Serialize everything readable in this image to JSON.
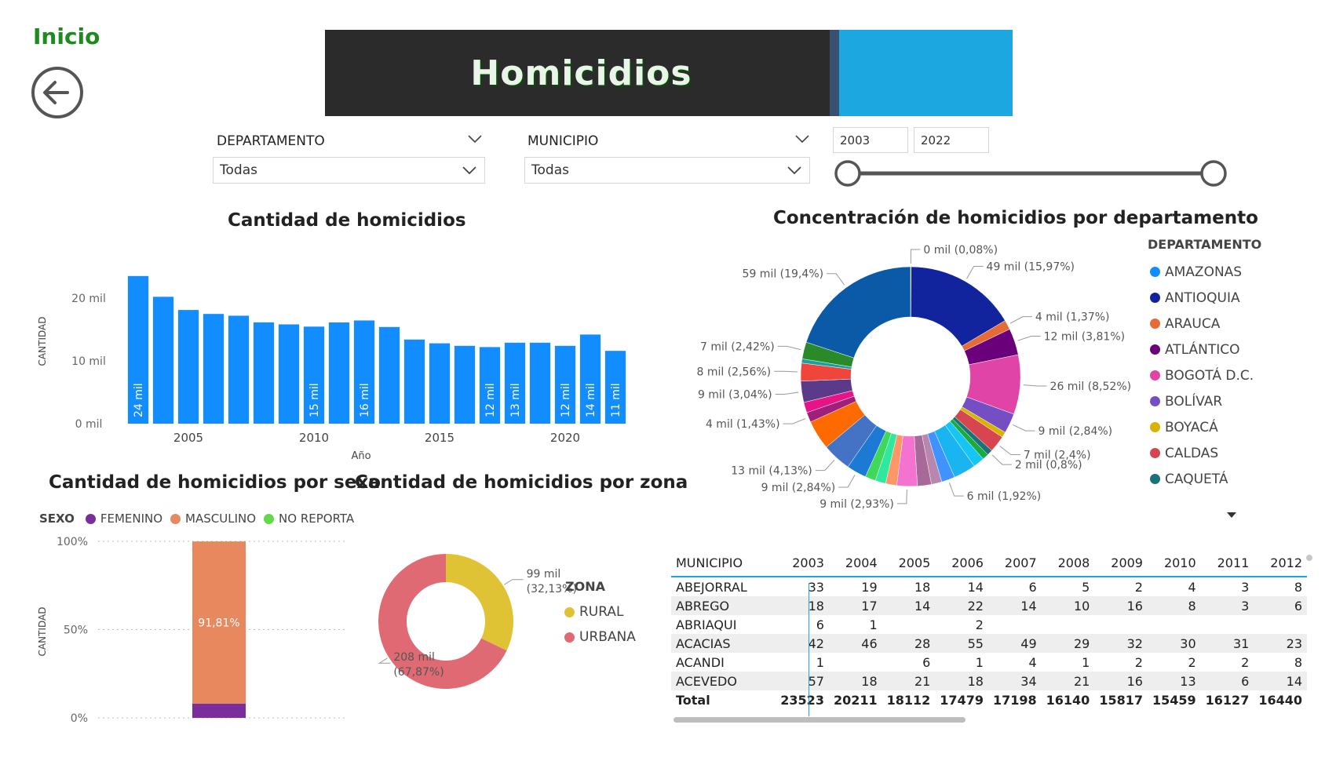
{
  "nav": {
    "label": "Inicio",
    "back_icon": "arrow-left-circle-icon"
  },
  "banner": {
    "title": "Homicidios",
    "colors": {
      "dark": "#2b2b2b",
      "accent": "#1ca7e0"
    }
  },
  "filters": {
    "departamento": {
      "label": "DEPARTAMENTO",
      "value": "Todas"
    },
    "municipio": {
      "label": "MUNICIPIO",
      "value": "Todas"
    },
    "year_range": {
      "start": "2003",
      "end": "2022"
    }
  },
  "charts": [
    {
      "id": "yearly",
      "chart_data": {
        "type": "bar",
        "title": "Cantidad de homicidios",
        "xlabel": "Año",
        "ylabel": "CANTIDAD",
        "x": [
          2003,
          2004,
          2005,
          2006,
          2007,
          2008,
          2009,
          2010,
          2011,
          2012,
          2013,
          2014,
          2015,
          2016,
          2017,
          2018,
          2019,
          2020,
          2021,
          2022
        ],
        "values": [
          23523,
          20211,
          18112,
          17479,
          17198,
          16140,
          15817,
          15459,
          16127,
          16440,
          15400,
          13400,
          12800,
          12400,
          12200,
          12900,
          12900,
          12400,
          14200,
          11600
        ],
        "data_labels": [
          "24 mil",
          "",
          "",
          "",
          "",
          "",
          "",
          "15 mil",
          "",
          "16 mil",
          "",
          "",
          "",
          "",
          "12 mil",
          "13 mil",
          "",
          "12 mil",
          "14 mil",
          "11 mil"
        ],
        "ylim": [
          0,
          25000
        ],
        "yticks": [
          {
            "v": 0,
            "label": "0 mil"
          },
          {
            "v": 10000,
            "label": "10 mil"
          },
          {
            "v": 20000,
            "label": "20 mil"
          }
        ],
        "xticks": [
          2005,
          2010,
          2015,
          2020
        ],
        "color": "#118dff"
      }
    },
    {
      "id": "departamento",
      "chart_data": {
        "type": "pie",
        "title": "Concentración de homicidios por departamento",
        "legend_title": "DEPARTAMENTO",
        "legend": [
          {
            "name": "AMAZONAS",
            "color": "#118dff"
          },
          {
            "name": "ANTIOQUIA",
            "color": "#12239e"
          },
          {
            "name": "ARAUCA",
            "color": "#e66c37"
          },
          {
            "name": "ATLÁNTICO",
            "color": "#6b007b"
          },
          {
            "name": "BOGOTÁ D.C.",
            "color": "#e044a7"
          },
          {
            "name": "BOLÍVAR",
            "color": "#744ec2"
          },
          {
            "name": "BOYACÁ",
            "color": "#d9b300"
          },
          {
            "name": "CALDAS",
            "color": "#d64550"
          },
          {
            "name": "CAQUETÁ",
            "color": "#197278"
          }
        ],
        "slices": [
          {
            "value": 0.08,
            "color": "#e66c37",
            "label": "0 mil (0,08%)"
          },
          {
            "value": 15.97,
            "color": "#12239e",
            "label": "49 mil (15,97%)"
          },
          {
            "value": 1.37,
            "color": "#e66c37",
            "label": "4 mil (1,37%)"
          },
          {
            "value": 3.81,
            "color": "#6b007b",
            "label": "12 mil (3,81%)"
          },
          {
            "value": 8.52,
            "color": "#e044a7",
            "label": "26 mil (8,52%)"
          },
          {
            "value": 2.84,
            "color": "#744ec2",
            "label": "9 mil (2,84%)"
          },
          {
            "value": 0.8,
            "color": "#d9b300",
            "label": ""
          },
          {
            "value": 2.4,
            "color": "#d64550",
            "label": "7 mil (2,4%)"
          },
          {
            "value": 0.8,
            "color": "#197278",
            "label": "2 mil (0,8%)"
          },
          {
            "value": 0.9,
            "color": "#1aab40",
            "label": ""
          },
          {
            "value": 1.6,
            "color": "#15c6f4",
            "label": ""
          },
          {
            "value": 3.2,
            "color": "#1ab5f0",
            "label": ""
          },
          {
            "value": 1.92,
            "color": "#4092ff",
            "label": "6 mil (1,92%)"
          },
          {
            "value": 1.5,
            "color": "#b887ad",
            "label": ""
          },
          {
            "value": 2.0,
            "color": "#a66999",
            "label": ""
          },
          {
            "value": 2.93,
            "color": "#f472d0",
            "label": "9 mil (2,93%)"
          },
          {
            "value": 1.6,
            "color": "#fe9666",
            "label": ""
          },
          {
            "value": 1.5,
            "color": "#2ee8a0",
            "label": ""
          },
          {
            "value": 1.5,
            "color": "#3fd85a",
            "label": ""
          },
          {
            "value": 2.84,
            "color": "#1d7ad4",
            "label": "9 mil (2,84%)"
          },
          {
            "value": 4.13,
            "color": "#4472c4",
            "label": "13 mil (4,13%)"
          },
          {
            "value": 4.2,
            "color": "#ff6a00",
            "label": ""
          },
          {
            "value": 1.43,
            "color": "#a01f7a",
            "label": "4 mil (1,43%)"
          },
          {
            "value": 1.5,
            "color": "#e81487",
            "label": ""
          },
          {
            "value": 3.04,
            "color": "#5b3a8a",
            "label": "9 mil (3,04%)"
          },
          {
            "value": 2.56,
            "color": "#f0453a",
            "label": "8 mil (2,56%)"
          },
          {
            "value": 0.6,
            "color": "#1aa0a0",
            "label": ""
          },
          {
            "value": 2.42,
            "color": "#2a8a2a",
            "label": "7 mil (2,42%)"
          },
          {
            "value": 19.4,
            "color": "#0a5aa8",
            "label": "59 mil (19,4%)"
          }
        ]
      }
    },
    {
      "id": "sexo",
      "chart_data": {
        "type": "bar",
        "title": "Cantidad de homicidios por sexo",
        "ylabel": "CANTIDAD",
        "legend_title": "SEXO",
        "series": [
          {
            "name": "FEMENINO",
            "color": "#7b2d9b",
            "value": 8.1
          },
          {
            "name": "MASCULINO",
            "color": "#e8885e",
            "value": 91.81,
            "label": "91,81%"
          },
          {
            "name": "NO REPORTA",
            "color": "#62d94a",
            "value": 0.09
          }
        ],
        "yticks": [
          "0%",
          "50%",
          "100%"
        ],
        "ylim": [
          0,
          100
        ]
      }
    },
    {
      "id": "zona",
      "chart_data": {
        "type": "pie",
        "title": "Cantidad de homicidios por zona",
        "legend_title": "ZONA",
        "slices": [
          {
            "name": "RURAL",
            "value": 32.13,
            "color": "#e0c235",
            "label_top": "99 mil",
            "label_bottom": "(32,13%)"
          },
          {
            "name": "URBANA",
            "value": 67.87,
            "color": "#e06a73",
            "label_top": "208 mil",
            "label_bottom": "(67,87%)"
          }
        ]
      }
    }
  ],
  "table": {
    "headers": [
      "MUNICIPIO",
      "2003",
      "2004",
      "2005",
      "2006",
      "2007",
      "2008",
      "2009",
      "2010",
      "2011",
      "2012"
    ],
    "rows": [
      [
        "ABEJORRAL",
        "33",
        "19",
        "18",
        "14",
        "6",
        "5",
        "2",
        "4",
        "3",
        "8"
      ],
      [
        "ABREGO",
        "18",
        "17",
        "14",
        "22",
        "14",
        "10",
        "16",
        "8",
        "3",
        "6"
      ],
      [
        "ABRIAQUI",
        "6",
        "1",
        "",
        "2",
        "",
        "",
        "",
        "",
        "",
        ""
      ],
      [
        "ACACIAS",
        "42",
        "46",
        "28",
        "55",
        "49",
        "29",
        "32",
        "30",
        "31",
        "23"
      ],
      [
        "ACANDI",
        "1",
        "",
        "6",
        "1",
        "4",
        "1",
        "2",
        "2",
        "2",
        "8"
      ],
      [
        "ACEVEDO",
        "57",
        "18",
        "21",
        "18",
        "34",
        "21",
        "16",
        "13",
        "6",
        "14"
      ]
    ],
    "total": [
      "Total",
      "23523",
      "20211",
      "18112",
      "17479",
      "17198",
      "16140",
      "15817",
      "15459",
      "16127",
      "16440"
    ]
  }
}
